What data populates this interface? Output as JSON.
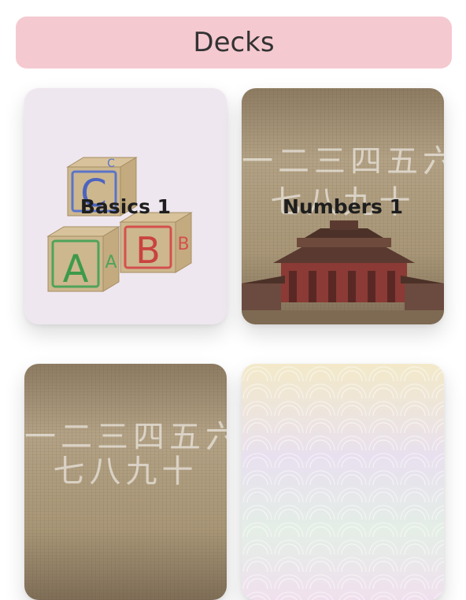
{
  "header": {
    "title": "Decks"
  },
  "decks": [
    {
      "name": "Basics 1",
      "art": "abc-blocks"
    },
    {
      "name": "Numbers 1",
      "art": "kanji-numbers-temple"
    },
    {
      "name": "",
      "art": "kanji-numbers-paper"
    },
    {
      "name": "",
      "art": "seigaiha-waves"
    }
  ],
  "art_text": {
    "kanji_row1": "一二三四五六",
    "kanji_row2": "七八九十",
    "blocks": [
      "A",
      "B",
      "C",
      "A",
      "B"
    ]
  },
  "colors": {
    "header_bg": "#f5c9d0",
    "card1_bg": "#efe7ef"
  }
}
